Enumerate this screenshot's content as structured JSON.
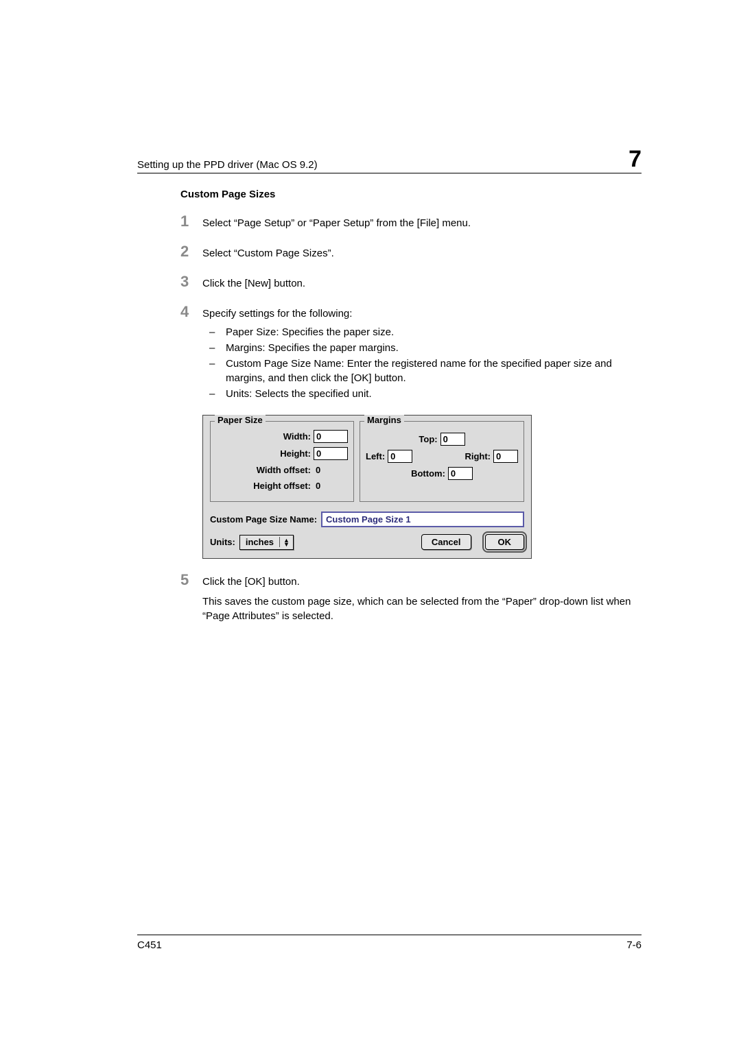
{
  "header": {
    "title": "Setting up the PPD driver (Mac OS 9.2)",
    "chapter": "7"
  },
  "section_title": "Custom Page Sizes",
  "steps": [
    {
      "num": "1",
      "text": "Select “Page Setup” or “Paper Setup” from the [File] menu."
    },
    {
      "num": "2",
      "text": "Select “Custom Page Sizes”."
    },
    {
      "num": "3",
      "text": "Click the [New] button."
    },
    {
      "num": "4",
      "text": "Specify settings for the following:",
      "subs": [
        "Paper Size: Specifies the paper size.",
        "Margins: Specifies the paper margins.",
        "Custom Page Size Name: Enter the registered name for the specified paper size and margins, and then click the [OK] button.",
        "Units: Selects the specified unit."
      ]
    },
    {
      "num": "5",
      "text": "Click the [OK] button.",
      "after": "This saves the custom page size, which can be selected from the “Paper” drop-down list when “Page Attributes” is selected."
    }
  ],
  "dialog": {
    "paper_size": {
      "legend": "Paper Size",
      "width_label": "Width:",
      "width": "0",
      "height_label": "Height:",
      "height": "0",
      "width_offset_label": "Width offset:",
      "width_offset": "0",
      "height_offset_label": "Height offset:",
      "height_offset": "0"
    },
    "margins": {
      "legend": "Margins",
      "top_label": "Top:",
      "top": "0",
      "left_label": "Left:",
      "left": "0",
      "right_label": "Right:",
      "right": "0",
      "bottom_label": "Bottom:",
      "bottom": "0"
    },
    "name_label": "Custom Page Size Name:",
    "name_value": "Custom Page Size 1",
    "units_label": "Units:",
    "units_value": "inches",
    "cancel": "Cancel",
    "ok": "OK"
  },
  "footer": {
    "left": "C451",
    "right": "7-6"
  }
}
